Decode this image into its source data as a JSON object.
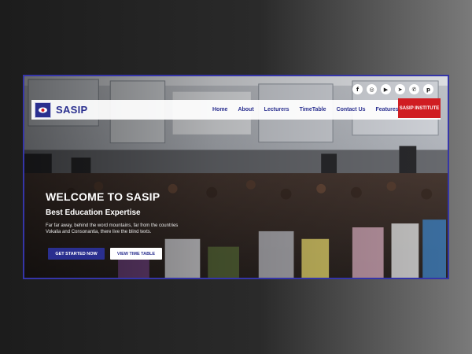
{
  "site": {
    "brand_name": "SASIP",
    "accent_color": "#2a2f8f",
    "cta_color": "#d01d22"
  },
  "socials": [
    {
      "icon": "facebook-icon",
      "glyph": "f"
    },
    {
      "icon": "instagram-icon",
      "glyph": "◎"
    },
    {
      "icon": "youtube-icon",
      "glyph": "▶"
    },
    {
      "icon": "telegram-icon",
      "glyph": "➤"
    },
    {
      "icon": "whatsapp-icon",
      "glyph": "✆"
    },
    {
      "icon": "pinterest-icon",
      "glyph": "p"
    }
  ],
  "nav": {
    "items": [
      "Home",
      "About",
      "Lecturers",
      "TimeTable",
      "Contact Us",
      "Features"
    ],
    "cta_label": "SASIP INSTITUTE"
  },
  "hero": {
    "title": "WELCOME TO SASIP",
    "subtitle": "Best Education Expertise",
    "description_line1": "Far far away, behind the word mountains, far from the countries",
    "description_line2": "Vokalia and Consonantia, there live the blind texts.",
    "primary_button": "GET STARTED NOW",
    "secondary_button": "VIEW TIME TABLE"
  }
}
